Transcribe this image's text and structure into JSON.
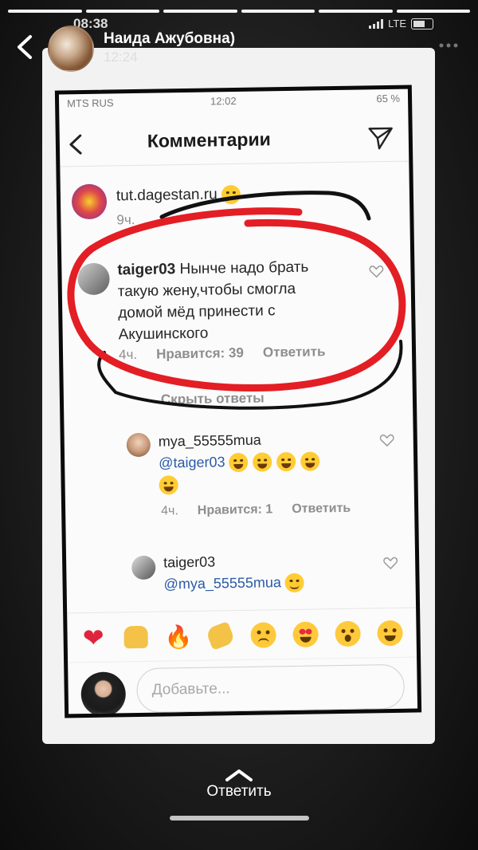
{
  "status_bar": {
    "time": "08:38",
    "network": "LTE"
  },
  "story": {
    "user_name": "Наида Ажубовна)",
    "time": "12:24"
  },
  "screenshot": {
    "status_carrier": "MTS RUS",
    "status_time": "12:02",
    "status_battery": "65 %",
    "nav_title": "Комментарии",
    "caption": {
      "username": "tut.dagestan.ru",
      "time": "9ч."
    },
    "comment": {
      "username": "taiger03",
      "lines": [
        "Нынче надо брать",
        "такую жену,чтобы смогла",
        "домой мёд принести с",
        "Акушинского"
      ],
      "time": "4ч.",
      "likes": "Нравится: 39",
      "reply": "Ответить"
    },
    "hide_replies": "Скрыть ответы",
    "reply1": {
      "username": "mya_55555mua",
      "mention": "@taiger03",
      "time": "4ч.",
      "likes": "Нравится: 1",
      "reply": "Ответить"
    },
    "reply2": {
      "username": "taiger03",
      "mention": "@mya_55555mua"
    },
    "input_placeholder": "Добавьте...",
    "reactions": [
      "heart",
      "raised-hands",
      "fire",
      "clapping-hands",
      "crying-face",
      "heart-eyes-face",
      "astonished-face",
      "tears-of-joy-face"
    ]
  },
  "footer": {
    "reply_label": "Ответить"
  },
  "colors": {
    "annotation_red": "#e31e24",
    "annotation_black": "#111111",
    "background": "#111111"
  }
}
